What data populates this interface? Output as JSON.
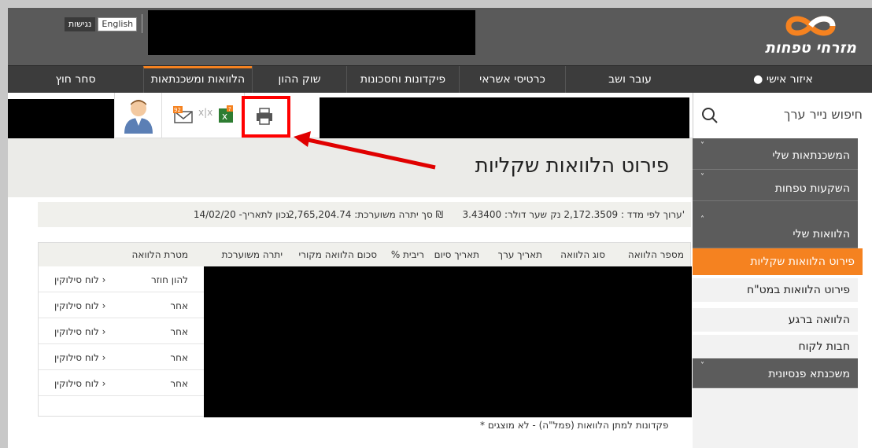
{
  "header": {
    "lang_hebrew": "נגישות",
    "lang_english": "English",
    "logo_text": "מזרחי טפחות",
    "brand_color": "#f58220"
  },
  "nav": {
    "items": [
      {
        "label": "איזור אישי"
      },
      {
        "label": "עובר ושב"
      },
      {
        "label": "כרטיסי אשראי"
      },
      {
        "label": "פיקדונות וחסכונות"
      },
      {
        "label": "שוק ההון"
      },
      {
        "label": "הלוואות ומשכנתאות"
      },
      {
        "label": "סחר חוץ"
      }
    ]
  },
  "toolbar": {
    "icons": [
      "person-avatar-icon",
      "email-icon",
      "excel-icon",
      "printer-icon"
    ],
    "email_badge": "92",
    "search_placeholder": "חיפוש נייר ערך"
  },
  "page": {
    "title": "פירוט הלוואות שקליות"
  },
  "sidebar": {
    "sections": [
      {
        "label": "המשכנתאות שלי"
      },
      {
        "label": "השקעות טפחות"
      },
      {
        "label": "הלוואות שלי"
      }
    ],
    "sub_items": [
      {
        "label": "פירוט הלוואות שקליות"
      },
      {
        "label": "פירוט הלוואות במט\"ח"
      },
      {
        "label": "הלוואה ברגע"
      },
      {
        "label": "חבות לקוח"
      }
    ],
    "last_section": "משכנתא פנסיונית"
  },
  "info": {
    "index_value": "ערוך לפי מדד : 2,172.3509 נק'",
    "dollar_rate": "שער דולר: 3.43400",
    "total_balance": "סך יתרה משוערכת: 2,765,204.74 ₪",
    "as_of_date": "נכון לתאריך- 14/02/20"
  },
  "table": {
    "headers": [
      "מספר הלוואה",
      "סוג הלוואה",
      "תאריך ערך",
      "תאריך סיום",
      "% ריבית",
      "סכום הלוואה מקורי",
      "יתרה משוערכת",
      "מטרת הלוואה"
    ],
    "rows": [
      {
        "purpose": "להון חוזר",
        "link": "לוח סילוקין ›"
      },
      {
        "purpose": "אחר",
        "link": "לוח סילוקין ›"
      },
      {
        "purpose": "אחר",
        "link": "לוח סילוקין ›"
      },
      {
        "purpose": "אחר",
        "link": "לוח סילוקין ›"
      },
      {
        "purpose": "אחר",
        "link": "לוח סילוקין ›"
      }
    ]
  },
  "footnote": "* פקדונות למתן הלוואות (פמל\"ה) - לא מוצגים"
}
